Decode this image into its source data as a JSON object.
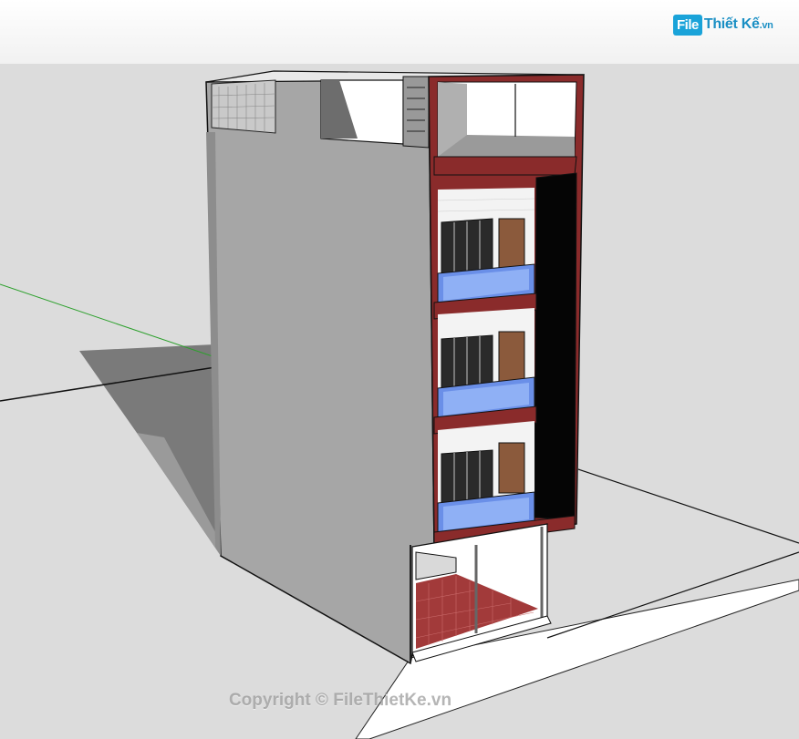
{
  "watermark": {
    "logo_file": "File",
    "logo_rest": "Thiết Kế",
    "logo_domain": ".vn",
    "copyright": "Copyright © FileThietKe.vn"
  },
  "colors": {
    "ground": "#dcdcdc",
    "wall_side": "#a9a9a9",
    "facade_red": "#8a2b2b",
    "glass_blue": "#6a8fe8",
    "door_brown": "#8b5a3c",
    "floor_red": "#a23a3a",
    "axis_green": "#2ca02c"
  }
}
